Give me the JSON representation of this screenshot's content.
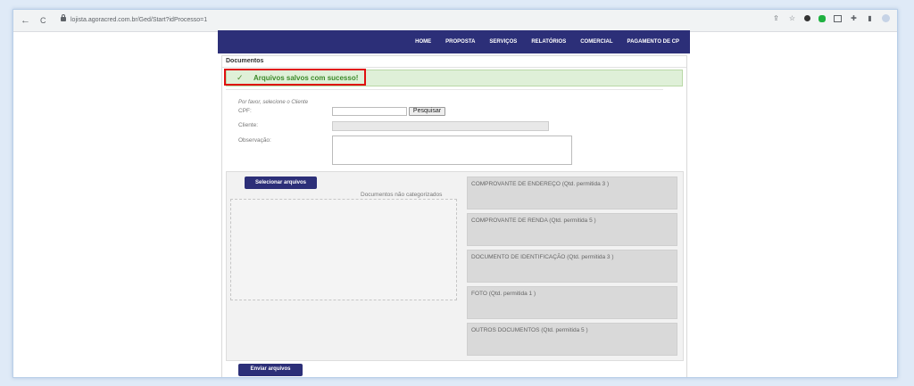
{
  "browser": {
    "back": "←",
    "reload": "C",
    "url": "lojista.agoracred.com.br/Ged/Start?idProcesso=1"
  },
  "menu": {
    "items": [
      "HOME",
      "PROPOSTA",
      "SERVIÇOS",
      "RELATÓRIOS",
      "COMERCIAL",
      "PAGAMENTO DE CP"
    ]
  },
  "page": {
    "title": "Documentos",
    "alert": {
      "icon": "✓",
      "text": "Arquivos salvos com sucesso!",
      "color": "#3c8a2a"
    },
    "hint": "Por favor, selecione o Cliente",
    "cpf_label": "CPF:",
    "cpf_value": "",
    "search_button": "Pesquisar",
    "cliente_label": "Cliente:",
    "cliente_value": "",
    "observacao_label": "Observação:",
    "observacao_value": ""
  },
  "upload": {
    "select_button": "Selecionar arquivos",
    "uncategorized_label": "Documentos não categorizados",
    "categories": [
      "COMPROVANTE DE ENDEREÇO (Qtd. permitida 3 )",
      "COMPROVANTE DE RENDA (Qtd. permitida 5 )",
      "DOCUMENTO DE IDENTIFICAÇÃO (Qtd. permitida 3 )",
      "FOTO (Qtd. permitida 1 )",
      "OUTROS DOCUMENTOS (Qtd. permitida 5 )"
    ],
    "send_button": "Enviar arquivos"
  },
  "colors": {
    "header": "#2c2f78",
    "alert_bg": "#dff0d8",
    "highlight": "#e01010"
  }
}
